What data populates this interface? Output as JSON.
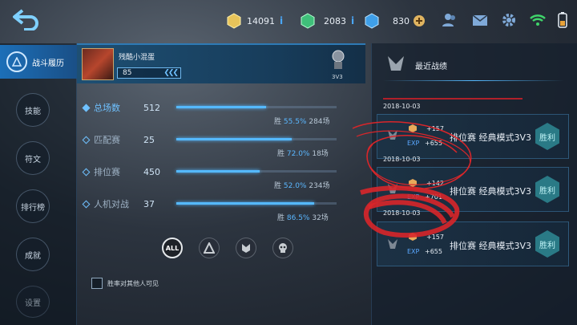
{
  "topbar": {
    "gold": "14091",
    "jade": "2083",
    "diamond": "830",
    "info": "i"
  },
  "nav": {
    "active": "战斗履历",
    "items": [
      "技能",
      "符文",
      "排行榜",
      "成就",
      "设置"
    ]
  },
  "profile": {
    "name": "残酷小混蛋",
    "level": "85",
    "mode_badge": "3V3"
  },
  "stats": [
    {
      "label": "总场数",
      "value": "512",
      "win_label": "胜",
      "win_rate": "55.5%",
      "games": "284场",
      "fill": 0.56
    },
    {
      "label": "匹配赛",
      "value": "25",
      "win_label": "胜",
      "win_rate": "72.0%",
      "games": "18场",
      "fill": 0.72
    },
    {
      "label": "排位赛",
      "value": "450",
      "win_label": "胜",
      "win_rate": "52.0%",
      "games": "234场",
      "fill": 0.52
    },
    {
      "label": "人机对战",
      "value": "37",
      "win_label": "胜",
      "win_rate": "86.5%",
      "games": "32场",
      "fill": 0.86
    }
  ],
  "filters": [
    "ALL"
  ],
  "visibility_option": "胜率对其他人可见",
  "recent": {
    "title": "最近战绩",
    "matches": [
      {
        "date": "2018-10-03",
        "gold": "+157",
        "exp_label": "EXP",
        "exp": "+655",
        "mode": "排位赛 经典模式3V3",
        "result": "胜利"
      },
      {
        "date": "2018-10-03",
        "gold": "+142",
        "exp_label": "EXP",
        "exp": "+701",
        "mode": "排位赛 经典模式3V3",
        "result": "胜利"
      },
      {
        "date": "2018-10-03",
        "gold": "+157",
        "exp_label": "EXP",
        "exp": "+655",
        "mode": "排位赛 经典模式3V3",
        "result": "胜利"
      }
    ]
  },
  "colors": {
    "accent": "#55b9ff",
    "annotation": "#d8262a"
  }
}
